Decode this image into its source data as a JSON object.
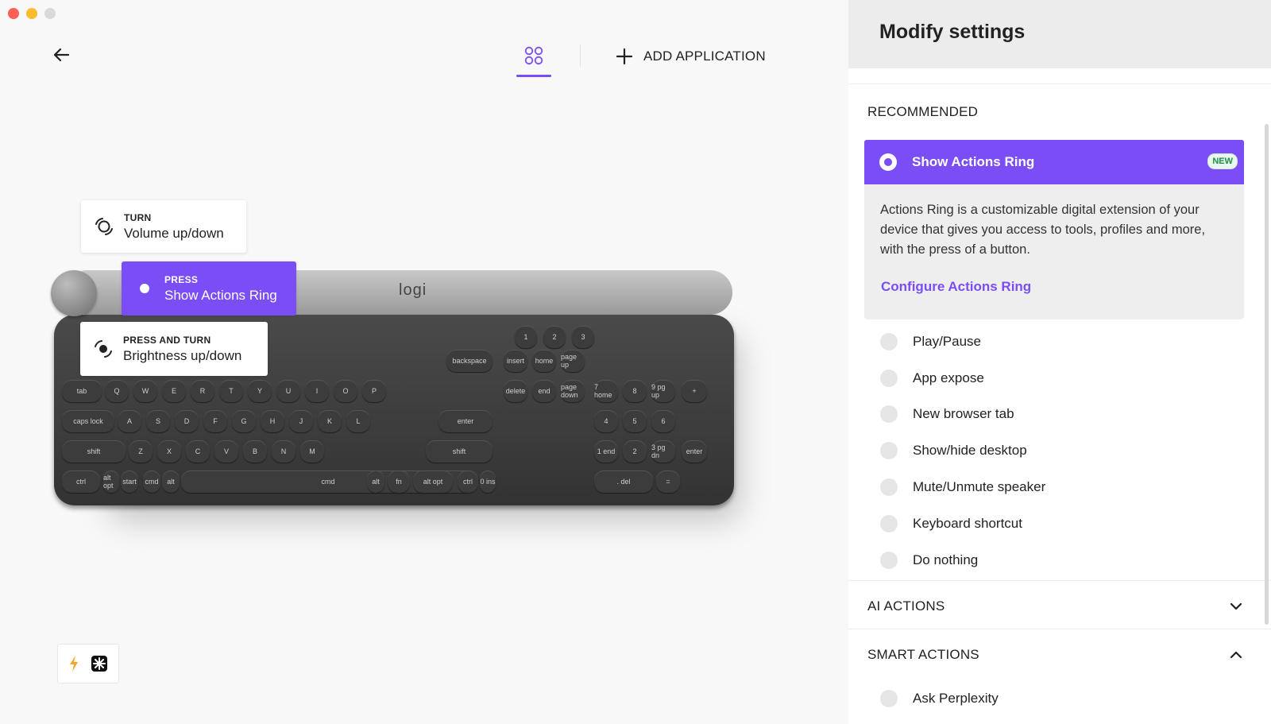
{
  "app": {
    "add_application_label": "ADD APPLICATION",
    "accent_color": "#7a4df5"
  },
  "icons": {
    "back": "arrow-left-icon",
    "apps": "apps-grid-icon",
    "add": "plus-icon",
    "turn": "rotate-dial-icon",
    "press": "press-dot-icon",
    "press_turn": "press-and-turn-icon",
    "lightning": "lightning-icon",
    "flow": "logi-flow-icon"
  },
  "keyboard": {
    "brand": "logi",
    "tooltips": [
      {
        "kind": "TURN",
        "action": "Volume up/down"
      },
      {
        "kind": "PRESS",
        "action": "Show Actions Ring"
      },
      {
        "kind": "PRESS AND TURN",
        "action": "Brightness up/down"
      }
    ],
    "rows": [
      [
        "1",
        "2",
        "3"
      ],
      [
        "backspace",
        "insert",
        "home",
        "page up"
      ],
      [
        "tab",
        "Q",
        "W",
        "E",
        "R",
        "T",
        "Y",
        "U",
        "I",
        "O",
        "P",
        "delete",
        "end",
        "page down",
        "7 home",
        "8",
        "9 pg up",
        "+"
      ],
      [
        "caps lock",
        "A",
        "S",
        "D",
        "F",
        "G",
        "H",
        "J",
        "K",
        "L",
        "enter",
        "4",
        "5",
        "6"
      ],
      [
        "shift",
        "Z",
        "X",
        "C",
        "V",
        "B",
        "N",
        "M",
        "shift",
        "1 end",
        "2",
        "3 pg dn",
        "enter"
      ],
      [
        "ctrl",
        "alt opt",
        "start",
        "cmd",
        "alt",
        "cmd",
        "alt",
        "fn",
        "alt opt",
        "ctrl",
        "0 ins",
        ". del",
        "="
      ]
    ]
  },
  "panel": {
    "title": "Modify settings",
    "recommended_title": "RECOMMENDED",
    "selected_option": "Show Actions Ring",
    "new_badge": "NEW",
    "description": "Actions Ring is a customizable digital extension of your device that gives you access to tools, profiles and more, with the press of a button.",
    "configure_link": "Configure Actions Ring",
    "options": [
      "Play/Pause",
      "App expose",
      "New browser tab",
      "Show/hide desktop",
      "Mute/Unmute speaker",
      "Keyboard shortcut",
      "Do nothing"
    ],
    "ai_actions_title": "AI ACTIONS",
    "smart_actions_title": "SMART ACTIONS",
    "smart_actions_items": [
      "Ask Perplexity"
    ]
  }
}
